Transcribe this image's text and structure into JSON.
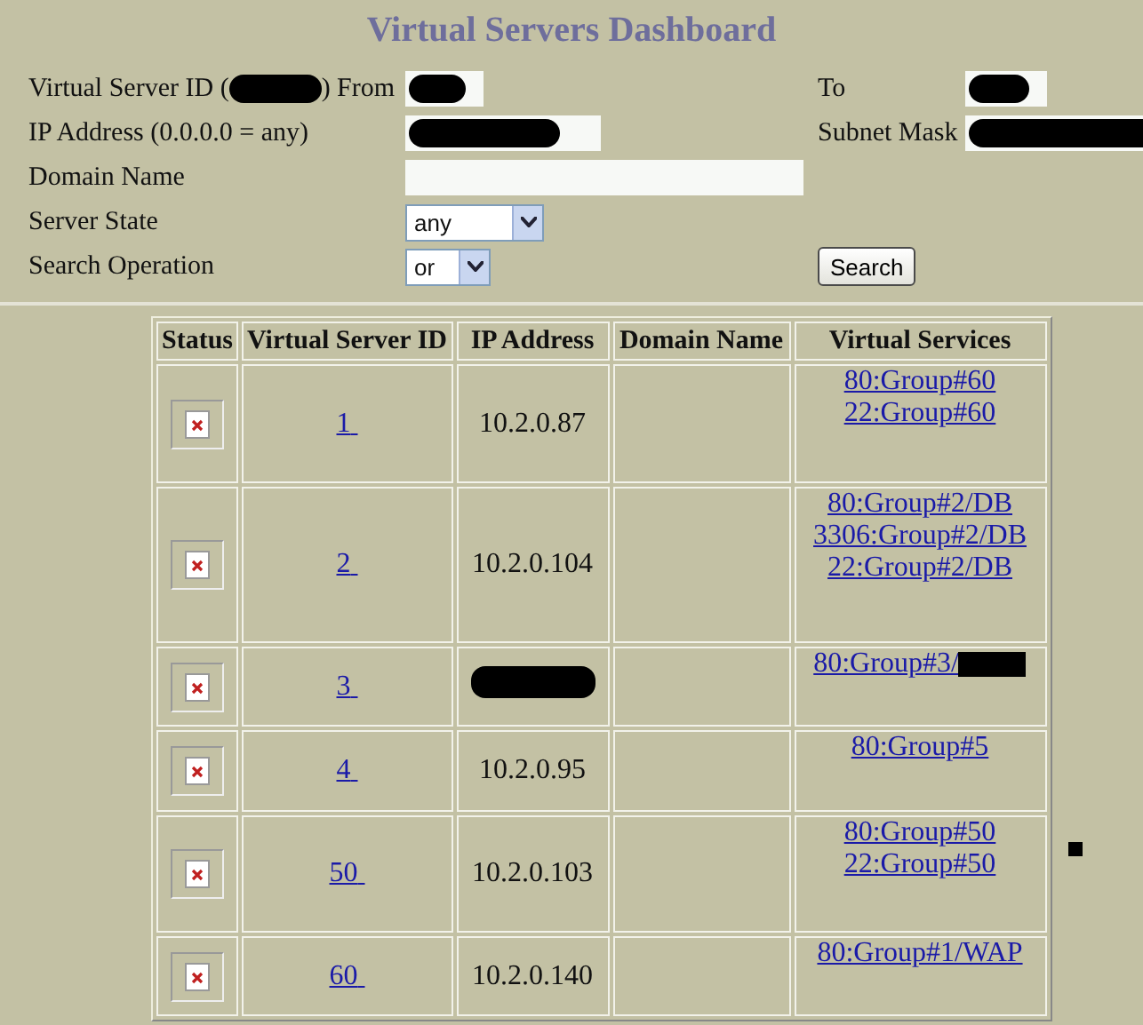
{
  "title": "Virtual Servers Dashboard",
  "search_form": {
    "rows": [
      {
        "label_parts": [
          "Virtual Server ID (",
          ") From"
        ],
        "field": {
          "kind": "redacted"
        },
        "right_label": "To",
        "right_field": {
          "kind": "redacted"
        }
      },
      {
        "label_parts": [
          "IP Address (0.0.0.0 = any)"
        ],
        "field": {
          "kind": "redacted"
        },
        "right_label": "Subnet Mask",
        "right_field": {
          "kind": "redacted"
        }
      },
      {
        "label_parts": [
          "Domain Name"
        ],
        "field": {
          "kind": "text"
        }
      },
      {
        "label_parts": [
          "Server State"
        ],
        "field": {
          "kind": "select",
          "value": "any"
        }
      },
      {
        "label_parts": [
          "Search Operation"
        ],
        "field": {
          "kind": "select",
          "value": "or"
        },
        "button": "Search"
      }
    ]
  },
  "table": {
    "columns": [
      "Status",
      "Virtual Server ID",
      "IP Address",
      "Domain Name",
      "Virtual Services"
    ],
    "rows": [
      {
        "id": "1",
        "ip": {
          "kind": "text",
          "text": "10.2.0.87"
        },
        "services": [
          {
            "kind": "link",
            "text": "80:Group#60"
          },
          {
            "kind": "link",
            "text": "22:Group#60"
          }
        ]
      },
      {
        "id": "2",
        "ip": {
          "kind": "text",
          "text": "10.2.0.104"
        },
        "services": [
          {
            "kind": "link",
            "text": "80:Group#2/DB"
          },
          {
            "kind": "link",
            "text": "3306:Group#2/DB"
          },
          {
            "kind": "link",
            "text": "22:Group#2/DB"
          }
        ]
      },
      {
        "id": "3",
        "ip": {
          "kind": "redacted"
        },
        "services": [
          {
            "kind": "link_redacted",
            "text": "80:Group#3/"
          }
        ]
      },
      {
        "id": "4",
        "ip": {
          "kind": "text",
          "text": "10.2.0.95"
        },
        "services": [
          {
            "kind": "link",
            "text": "80:Group#5"
          }
        ]
      },
      {
        "id": "50",
        "ip": {
          "kind": "text",
          "text": "10.2.0.103"
        },
        "services": [
          {
            "kind": "link",
            "text": "80:Group#50"
          },
          {
            "kind": "link",
            "text": "22:Group#50"
          }
        ]
      },
      {
        "id": "60",
        "ip": {
          "kind": "text",
          "text": "10.2.0.140"
        },
        "services": [
          {
            "kind": "link",
            "text": "80:Group#1/WAP"
          }
        ]
      }
    ]
  }
}
